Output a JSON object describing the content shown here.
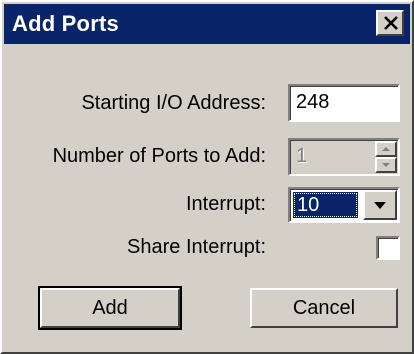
{
  "window": {
    "title": "Add Ports",
    "close_glyph": "close-icon"
  },
  "form": {
    "start_address_label": "Starting I/O Address:",
    "start_address_value": "248",
    "num_ports_label": "Number of Ports to Add:",
    "num_ports_value": "1",
    "num_ports_disabled": true,
    "interrupt_label": "Interrupt:",
    "interrupt_value": "10",
    "share_interrupt_label": "Share Interrupt:",
    "share_interrupt_checked": false
  },
  "buttons": {
    "add_label": "Add",
    "cancel_label": "Cancel"
  },
  "colors": {
    "title_bar": "#0a246a",
    "dialog_bg": "#d4d0c8",
    "selection": "#0a246a",
    "disabled_text": "#808080"
  }
}
